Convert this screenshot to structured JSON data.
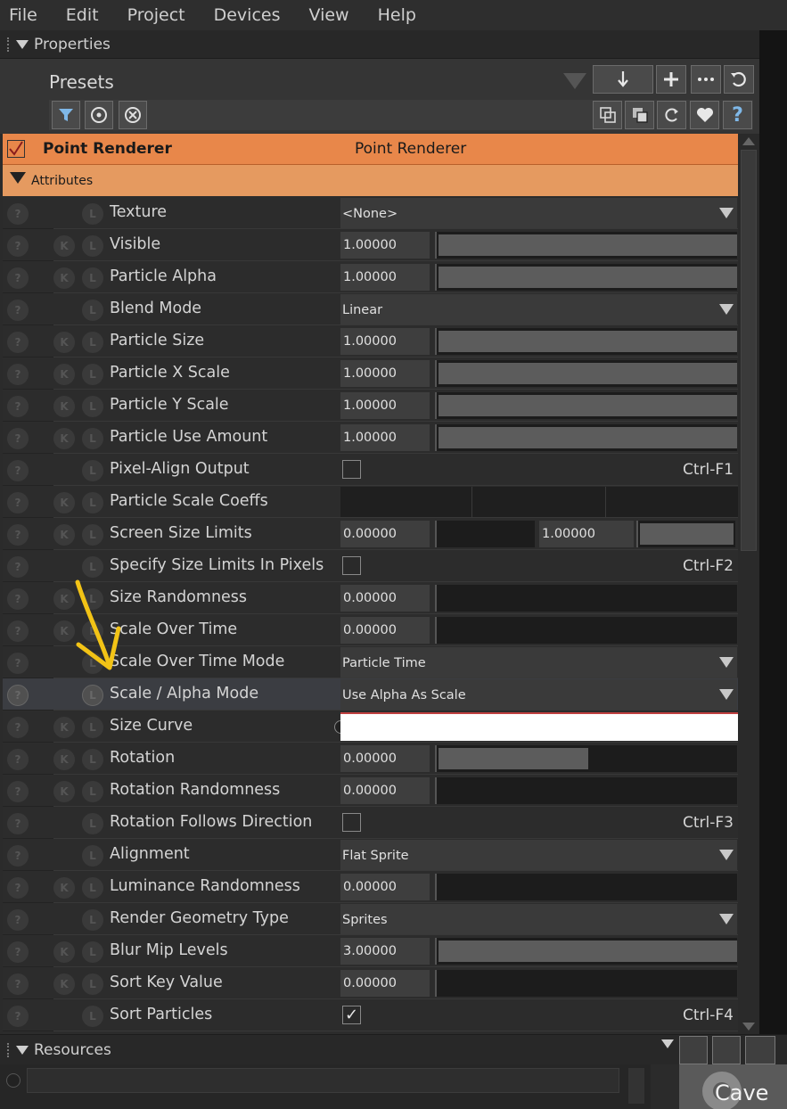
{
  "menu": [
    "File",
    "Edit",
    "Project",
    "Devices",
    "View",
    "Help"
  ],
  "properties_title": "Properties",
  "presets_label": "Presets",
  "component": {
    "name": "Point Renderer",
    "type": "Point Renderer"
  },
  "attributes_label": "Attributes",
  "circle_letters": {
    "q": "?",
    "k": "K",
    "l": "L"
  },
  "rows": [
    {
      "label": "Texture",
      "value": "<None>"
    },
    {
      "label": "Visible",
      "value": "1.00000",
      "fill": 1.0
    },
    {
      "label": "Particle Alpha",
      "value": "1.00000",
      "fill": 1.0
    },
    {
      "label": "Blend Mode",
      "value": "Linear"
    },
    {
      "label": "Particle Size",
      "value": "1.00000",
      "fill": 1.0
    },
    {
      "label": "Particle X Scale",
      "value": "1.00000",
      "fill": 1.0
    },
    {
      "label": "Particle Y Scale",
      "value": "1.00000",
      "fill": 1.0
    },
    {
      "label": "Particle Use Amount",
      "value": "1.00000",
      "fill": 1.0
    },
    {
      "label": "Pixel-Align Output",
      "checked": false,
      "shortcut": "Ctrl-F1"
    },
    {
      "label": "Particle Scale Coeffs"
    },
    {
      "label": "Screen Size Limits",
      "value": "0.00000",
      "value2": "1.00000"
    },
    {
      "label": "Specify Size Limits In Pixels",
      "checked": false,
      "shortcut": "Ctrl-F2"
    },
    {
      "label": "Size Randomness",
      "value": "0.00000",
      "fill": 0.0
    },
    {
      "label": "Scale Over Time",
      "value": "0.00000",
      "fill": 0.0
    },
    {
      "label": "Scale Over Time Mode",
      "value": "Particle Time"
    },
    {
      "label": "Scale / Alpha Mode",
      "value": "Use Alpha As Scale"
    },
    {
      "label": "Size Curve"
    },
    {
      "label": "Rotation",
      "value": "0.00000",
      "fill": 0.5
    },
    {
      "label": "Rotation Randomness",
      "value": "0.00000",
      "fill": 0.0
    },
    {
      "label": "Rotation Follows Direction",
      "checked": false,
      "shortcut": "Ctrl-F3"
    },
    {
      "label": "Alignment",
      "value": "Flat Sprite"
    },
    {
      "label": "Luminance Randomness",
      "value": "0.00000",
      "fill": 0.0
    },
    {
      "label": "Render Geometry Type",
      "value": "Sprites"
    },
    {
      "label": "Blur Mip Levels",
      "value": "3.00000",
      "fill": 1.0
    },
    {
      "label": "Sort Key Value",
      "value": "0.00000",
      "fill": 0.0
    },
    {
      "label": "Sort Particles",
      "checked": true,
      "check_glyph": "✓",
      "shortcut": "Ctrl-F4"
    }
  ],
  "resources_title": "Resources",
  "resource_item": "Cave",
  "colors": {
    "component_header": "#e8874a",
    "attributes_header": "#e59a60",
    "annotation_arrow": "#f2c316"
  }
}
